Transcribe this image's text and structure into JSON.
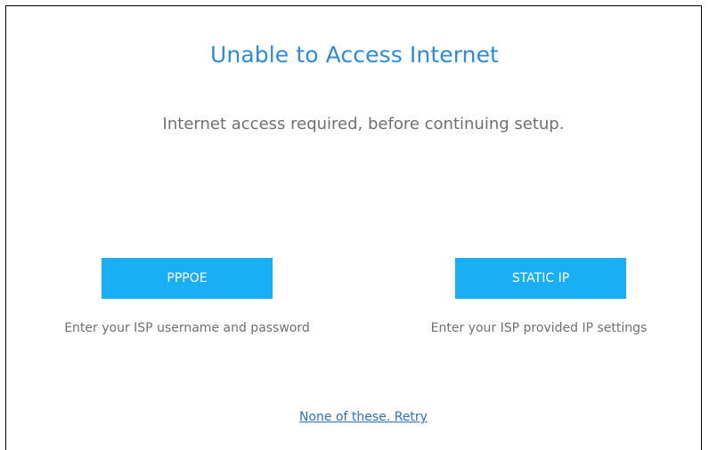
{
  "dialog": {
    "title": "Unable to Access Internet",
    "subtitle": "Internet access required, before continuing setup."
  },
  "options": [
    {
      "button_label": "PPPOE",
      "description": "Enter your ISP username and password"
    },
    {
      "button_label": "STATIC IP",
      "description": "Enter your ISP provided IP settings"
    }
  ],
  "retry_link": "None of these. Retry",
  "colors": {
    "title": "#2f8bd8",
    "button_bg": "#1aaef5",
    "text_gray": "#6f6f6f",
    "link": "#2f6fba"
  }
}
